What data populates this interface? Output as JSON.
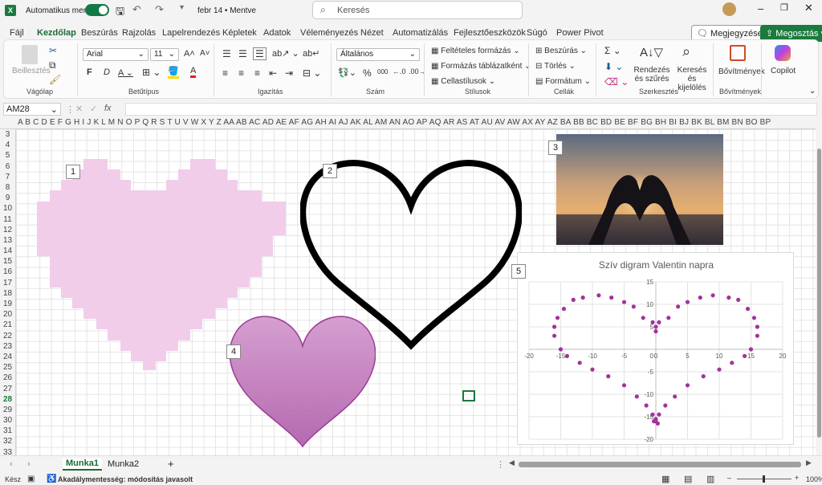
{
  "titlebar": {
    "autosave_label": "Automatikus mentés",
    "filename": "febr 14 • Mentve",
    "search_placeholder": "Keresés"
  },
  "menu": [
    "Fájl",
    "Kezdőlap",
    "Beszúrás",
    "Rajzolás",
    "Lapelrendezés",
    "Képletek",
    "Adatok",
    "Véleményezés",
    "Nézet",
    "Automatizálás",
    "Fejlesztőeszközök",
    "Súgó",
    "Power Pivot"
  ],
  "menu_active": "Kezdőlap",
  "top_buttons": {
    "comments": "Megjegyzések",
    "share": "Megosztás"
  },
  "ribbon": {
    "paste": "Beillesztés",
    "font_name": "Arial",
    "font_size": "11",
    "number_format": "Általános",
    "conditional": "Feltételes formázás",
    "format_table": "Formázás táblázatként",
    "cell_styles": "Cellastílusok",
    "insert": "Beszúrás",
    "delete": "Törlés",
    "format": "Formátum",
    "sort": "Rendezés és szűrés",
    "find": "Keresés és kijelölés",
    "addins": "Bővítmények",
    "copilot": "Copilot",
    "groups": [
      "Vágólap",
      "Betűtípus",
      "Igazítás",
      "Szám",
      "Stílusok",
      "Cellák",
      "Szerkesztés",
      "Bővítmények"
    ]
  },
  "namebox": "AM28",
  "fx": "fx",
  "columns": "A  B  C  D  E  F  G  H  I  J  K  L  M  N  O  P  Q  R  S  T  U  V  W  X  Y  Z  AA AB AC AD AE AF AG AH AI AJ AK AL AM AN AO AP AQ AR AS AT AU AV AW AX AY AZ BA BB BC BD BE BF BG BH BI BJ BK BL BM BN BO BP",
  "rows": [
    "3",
    "4",
    "5",
    "6",
    "7",
    "8",
    "9",
    "10",
    "11",
    "12",
    "13",
    "14",
    "15",
    "16",
    "17",
    "18",
    "19",
    "20",
    "21",
    "22",
    "23",
    "24",
    "25",
    "26",
    "27",
    "28",
    "29",
    "30",
    "31",
    "32",
    "33"
  ],
  "labels": [
    "1",
    "2",
    "3",
    "4",
    "5"
  ],
  "sheets": [
    "Munka1",
    "Munka2"
  ],
  "status": {
    "ready": "Kész",
    "accessibility": "Akadálymentesség: módosítás javasolt",
    "zoom": "100%"
  },
  "colors": {
    "accent": "#1b7a3e",
    "pixel_heart": "#f1cdea",
    "shape_heart_top": "#d59fd0",
    "shape_heart_bottom": "#b56ab0",
    "marker": "#a3329c"
  },
  "chart_data": {
    "type": "scatter",
    "title": "Szív digram Valentin napra",
    "xlim": [
      -20,
      20
    ],
    "ylim": [
      -20,
      15
    ],
    "xticks": [
      -20,
      -15,
      -10,
      -5,
      0,
      5,
      10,
      15,
      20
    ],
    "yticks": [
      -20,
      -15,
      -10,
      -5,
      0,
      5,
      10,
      15
    ],
    "grid": true,
    "series": [
      {
        "name": "",
        "points": [
          [
            0,
            5
          ],
          [
            0.5,
            6
          ],
          [
            2,
            7
          ],
          [
            3.5,
            9.5
          ],
          [
            5,
            10.5
          ],
          [
            7,
            11.5
          ],
          [
            9,
            12
          ],
          [
            11.5,
            11.5
          ],
          [
            13,
            11
          ],
          [
            14.5,
            9
          ],
          [
            15.5,
            7
          ],
          [
            16,
            5
          ],
          [
            16,
            3
          ],
          [
            15,
            0
          ],
          [
            14,
            -1.5
          ],
          [
            12,
            -3
          ],
          [
            10,
            -4.5
          ],
          [
            7.5,
            -6
          ],
          [
            5,
            -8
          ],
          [
            3,
            -10.5
          ],
          [
            1.5,
            -12.5
          ],
          [
            0.5,
            -14.5
          ],
          [
            0,
            -15.5
          ],
          [
            -0.5,
            6
          ],
          [
            -2,
            7
          ],
          [
            -3.5,
            9.5
          ],
          [
            -5,
            10.5
          ],
          [
            -7,
            11.5
          ],
          [
            -9,
            12
          ],
          [
            -11.5,
            11.5
          ],
          [
            -13,
            11
          ],
          [
            -14.5,
            9
          ],
          [
            -15.5,
            7
          ],
          [
            -16,
            5
          ],
          [
            -16,
            3
          ],
          [
            -15,
            0
          ],
          [
            -14,
            -1.5
          ],
          [
            -12,
            -3
          ],
          [
            -10,
            -4.5
          ],
          [
            -7.5,
            -6
          ],
          [
            -5,
            -8
          ],
          [
            -3,
            -10.5
          ],
          [
            -1.5,
            -12.5
          ],
          [
            -0.5,
            -14.5
          ],
          [
            0,
            4
          ],
          [
            0,
            -16
          ],
          [
            0.3,
            -16.5
          ],
          [
            -0.3,
            -16
          ]
        ]
      }
    ]
  }
}
